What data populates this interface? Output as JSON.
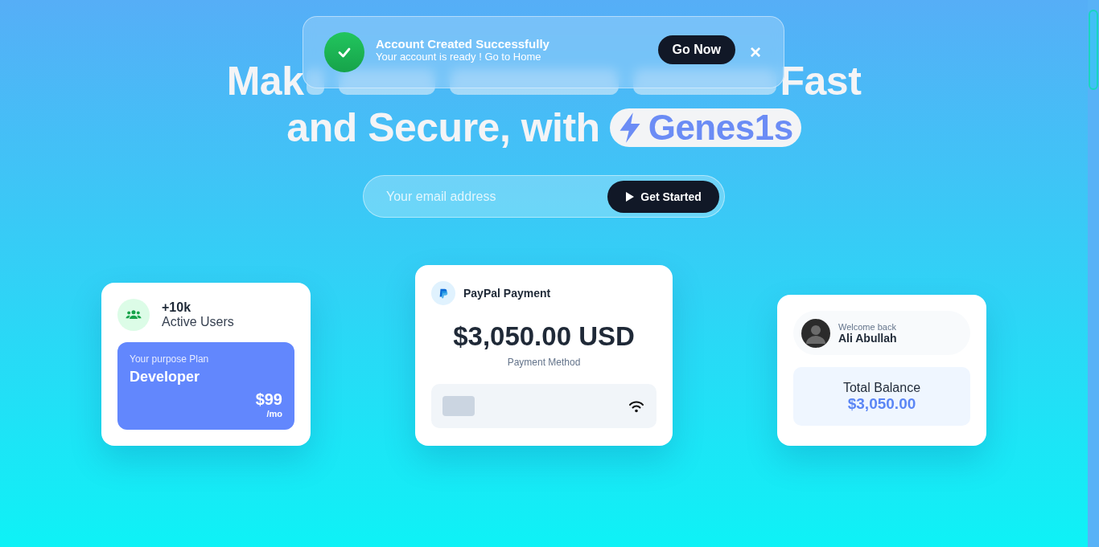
{
  "toast": {
    "title": "Account Created Successfully",
    "message": "Your account is ready ! Go to Home",
    "action": "Go Now",
    "close": "×"
  },
  "hero": {
    "title_line_1_start": "Mak",
    "title_line_1_end": "Fast",
    "title_line_2": "and Secure, with",
    "brand": "Genes1s"
  },
  "signup": {
    "placeholder": "Your email address",
    "button": "Get Started"
  },
  "users_card": {
    "count": "+10k",
    "label": "Active Users",
    "plan_caption": "Your purpose Plan",
    "plan_name": "Developer",
    "price": "$99",
    "period": "/mo"
  },
  "payment_card": {
    "title": "PayPal Payment",
    "amount": "$3,050.00 USD",
    "caption": "Payment Method"
  },
  "balance_card": {
    "greeting": "Welcome back",
    "name": "Ali Abullah",
    "label": "Total Balance",
    "amount": "$3,050.00"
  }
}
